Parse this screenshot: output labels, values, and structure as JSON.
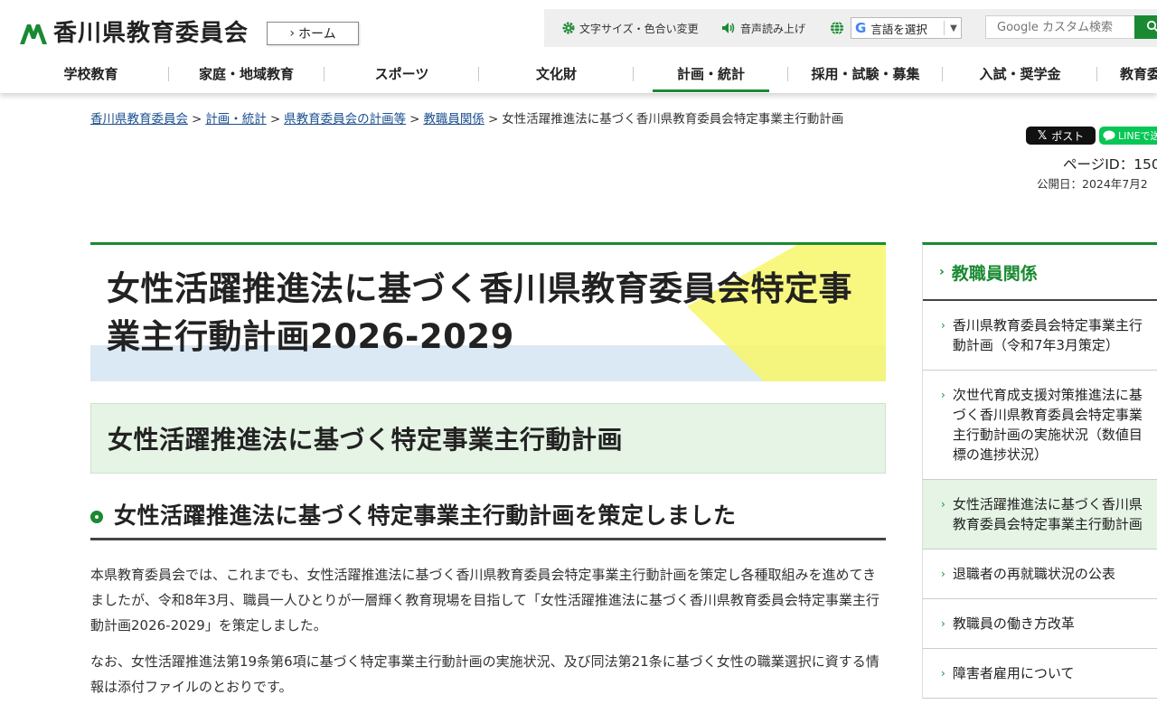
{
  "header": {
    "site_name": "香川県教育委員会",
    "home_label": "ホーム",
    "toolbar": {
      "font_color_label": "文字サイズ・色合い変更",
      "voice_label": "音声読み上げ",
      "language_select": "言語を選択",
      "search_placeholder": "Google カスタム検索"
    },
    "nav": [
      {
        "label": "学校教育"
      },
      {
        "label": "家庭・地域教育"
      },
      {
        "label": "スポーツ"
      },
      {
        "label": "文化財"
      },
      {
        "label": "計画・統計",
        "active": true
      },
      {
        "label": "採用・試験・募集"
      },
      {
        "label": "入試・奨学金"
      },
      {
        "label": "教育委員"
      }
    ]
  },
  "breadcrumb": {
    "items": [
      "香川県教育委員会",
      "計画・統計",
      "県教育委員会の計画等",
      "教職員関係"
    ],
    "current": "女性活躍推進法に基づく香川県教育委員会特定事業主行動計画",
    "separator": ">"
  },
  "share": {
    "x_label": "ポスト",
    "line_label": "LINEで送る"
  },
  "meta": {
    "page_id": "ページID：150",
    "published": "公開日：2024年7月2"
  },
  "main": {
    "title": "女性活躍推進法に基づく香川県教育委員会特定事業主行動計画2026-2029",
    "h2": "女性活躍推進法に基づく特定事業主行動計画",
    "h3": "女性活躍推進法に基づく特定事業主行動計画を策定しました",
    "paragraphs": [
      "本県教育委員会では、これまでも、女性活躍推進法に基づく香川県教育委員会特定事業主行動計画を策定し各種取組みを進めてきましたが、令和8年3月、職員一人ひとりが一層輝く教育現場を目指して「女性活躍推進法に基づく香川県教育委員会特定事業主行動計画2026-2029」を策定しました。",
      "なお、女性活躍推進法第19条第6項に基づく特定事業主行動計画の実施状況、及び同法第21条に基づく女性の職業選択に資する情報は添付ファイルのとおりです。"
    ]
  },
  "side_nav": {
    "heading": "教職員関係",
    "items": [
      {
        "label": "香川県教育委員会特定事業主行動計画（令和7年3月策定）"
      },
      {
        "label": "次世代育成支援対策推進法に基づく香川県教育委員会特定事業主行動計画の実施状況（数値目標の進捗状況）"
      },
      {
        "label": "女性活躍推進法に基づく香川県教育委員会特定事業主行動計画",
        "current": true
      },
      {
        "label": "退職者の再就職状況の公表"
      },
      {
        "label": "教職員の働き方改革"
      },
      {
        "label": "障害者雇用について"
      }
    ]
  },
  "colors": {
    "brand_green": "#1a8a32",
    "link_blue": "#1a4f8f",
    "h2_bg": "#e5f4e5",
    "title_blue_band": "#dbe9f5",
    "title_yellow": "#f7f76a"
  },
  "icons": [
    "kagawa-logo-icon",
    "gear-icon",
    "speaker-icon",
    "globe-icon",
    "search-icon",
    "chevron-right-icon"
  ]
}
